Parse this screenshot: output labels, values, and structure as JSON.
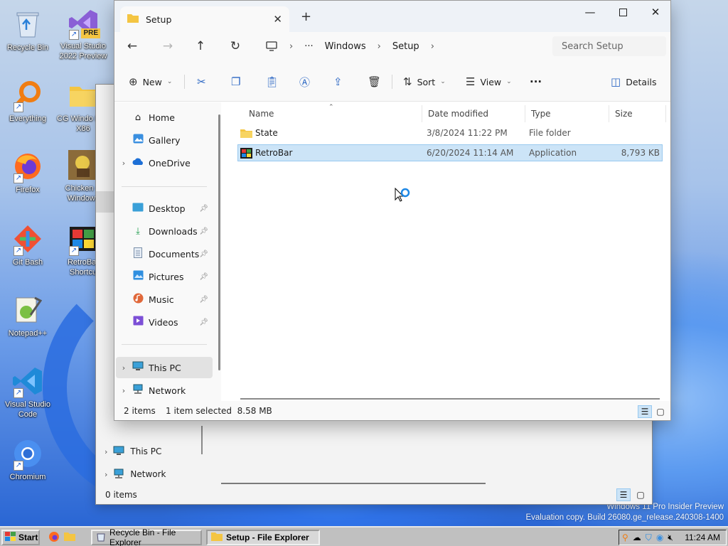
{
  "desktop": {
    "icons": [
      {
        "label": "Recycle Bin"
      },
      {
        "label": "Visual Studio 2022 Preview",
        "badge": "PRE"
      },
      {
        "label": "Everything"
      },
      {
        "label": "CG Windo Port X86"
      },
      {
        "label": "Firefox"
      },
      {
        "label": "Chicken C Windows"
      },
      {
        "label": "Git Bash"
      },
      {
        "label": "RetroBar Shortcu"
      },
      {
        "label": "Notepad++"
      },
      {
        "label": "Visual Studio Code"
      },
      {
        "label": "Chromium"
      }
    ],
    "watermark_line1": "Windows 11 Pro Insider Preview",
    "watermark_line2": "Evaluation copy. Build 26080.ge_release.240308-1400"
  },
  "back_window": {
    "nav": [
      {
        "label": "This PC"
      },
      {
        "label": "Network"
      }
    ],
    "status": "0 items"
  },
  "window": {
    "tab_title": "Setup",
    "breadcrumbs": [
      "Windows",
      "Setup"
    ],
    "overflow": "···",
    "search_placeholder": "Search Setup",
    "toolbar": {
      "new_label": "New",
      "sort_label": "Sort",
      "view_label": "View",
      "more_label": "···",
      "details_label": "Details"
    },
    "nav": {
      "home": "Home",
      "gallery": "Gallery",
      "onedrive": "OneDrive",
      "desktop": "Desktop",
      "downloads": "Downloads",
      "documents": "Documents",
      "pictures": "Pictures",
      "music": "Music",
      "videos": "Videos",
      "thispc": "This PC",
      "network": "Network"
    },
    "columns": {
      "name": "Name",
      "date": "Date modified",
      "type": "Type",
      "size": "Size"
    },
    "files": [
      {
        "name": "State",
        "date": "3/8/2024 11:22 PM",
        "type": "File folder",
        "size": ""
      },
      {
        "name": "RetroBar",
        "date": "6/20/2024 11:14 AM",
        "type": "Application",
        "size": "8,793 KB"
      }
    ],
    "status": {
      "count": "2 items",
      "selection": "1 item selected  8.58 MB"
    }
  },
  "taskbar": {
    "start_label": "Start",
    "tasks": [
      {
        "label": "Recycle Bin - File Explorer"
      },
      {
        "label": "Setup - File Explorer"
      }
    ],
    "clock": "11:24 AM"
  },
  "colors": {
    "accent": "#2c67c4",
    "selection": "#cce4f7",
    "folder": "#f4c542"
  }
}
